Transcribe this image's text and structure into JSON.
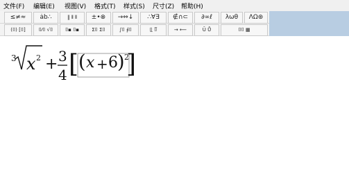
{
  "menu": {
    "items": [
      "文件(F)",
      "编辑(E)",
      "视图(V)",
      "格式(T)",
      "样式(S)",
      "尺寸(Z)",
      "帮助(H)"
    ]
  },
  "toolbar_row1": {
    "groups": [
      "≤≠≈",
      "ȧb∴",
      "‖ ⦀ ⦀",
      "±•⊗",
      "→⇔↓",
      "∴∀∃",
      "∉∩⊂",
      "∂∞ℓ",
      "λωθ",
      "ΛΩ⊛"
    ]
  },
  "toolbar_row2": {
    "groups": [
      "(⌷) [⌷]",
      "⌷⁄⌷ √⌷",
      "⌷▪ ⌷▪",
      "Σ⌷ Σ⌷",
      "∫⌷ ∮⌷",
      "⌷̲ ⌷̅",
      "→ ⟵",
      "Ū Ů",
      "⌷⌷ ▦"
    ]
  },
  "equation": {
    "root_index": "3",
    "radicand_base": "x",
    "radicand_exp": "2",
    "plus": "+",
    "frac_num": "3",
    "frac_den": "4",
    "inner_open": "(",
    "inner_var": "x",
    "inner_plus": "+",
    "inner_const": "6",
    "inner_close": ")",
    "inner_exp": "2",
    "bracket_open": "[",
    "bracket_close": "]"
  },
  "colors": {
    "menubar_bg": "#f0f0f0",
    "toolbar_bg": "#f3f3f3",
    "side_panel": "#b8cde2"
  }
}
